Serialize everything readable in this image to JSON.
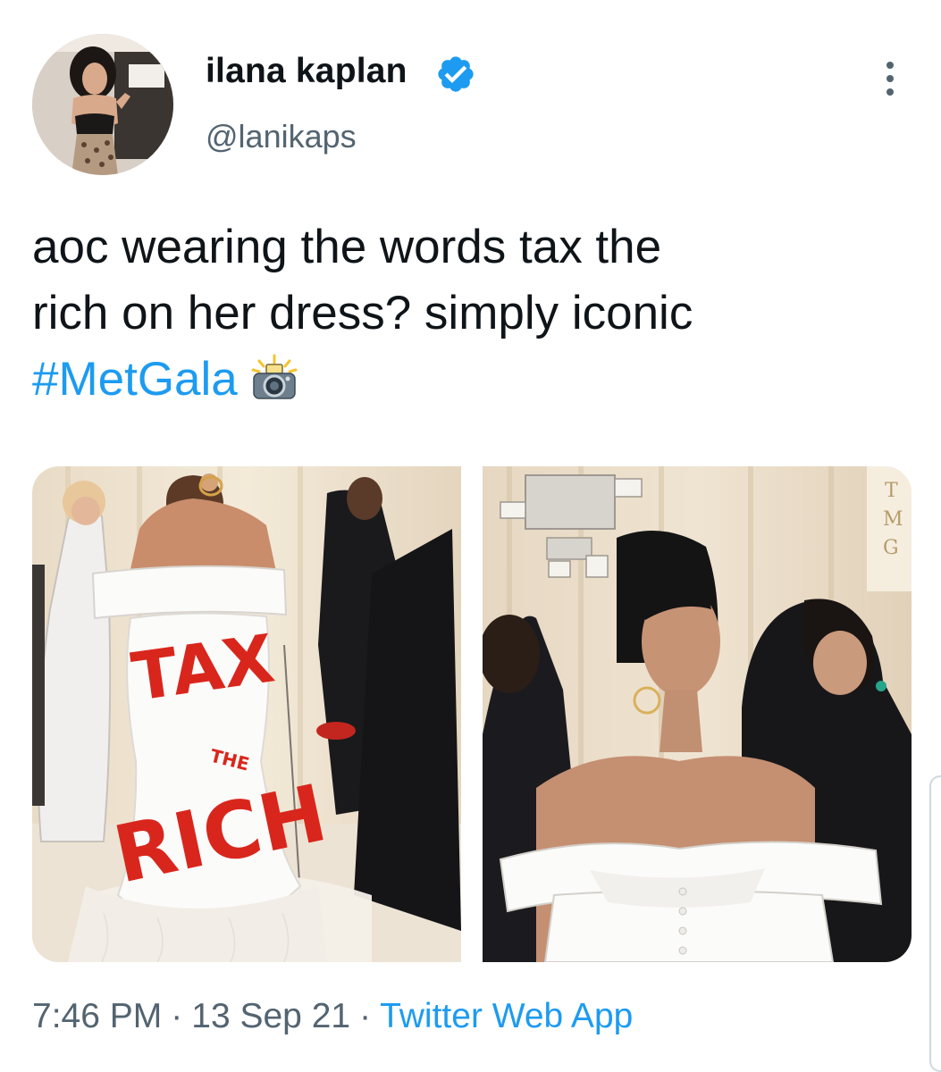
{
  "tweet": {
    "author": {
      "display_name": "ilana kaplan",
      "handle": "@lanikaps",
      "verified": true
    },
    "text_lines": [
      "aoc wearing the words tax the",
      "rich on her dress? simply iconic"
    ],
    "hashtag": "#MetGala",
    "emoji": "camera-with-flash",
    "dress_text": {
      "word1": "TAX",
      "word2": "THE",
      "word3": "RICH"
    },
    "backdrop_text": [
      "T",
      "M",
      "G"
    ],
    "time": "7:46 PM",
    "date": "13 Sep 21",
    "source": "Twitter Web App",
    "separator": "·"
  },
  "colors": {
    "link": "#1d9bf0",
    "secondary_text": "#536471",
    "primary_text": "#0f1419",
    "dress_paint": "#d9261c"
  }
}
